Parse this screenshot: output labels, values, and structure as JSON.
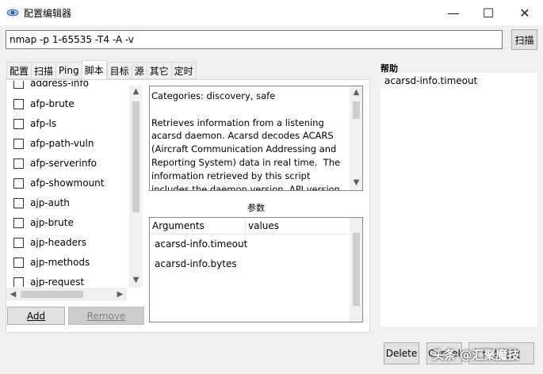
{
  "window": {
    "title": "配置编辑器",
    "controls": {
      "minimize": "—",
      "maximize": "☐",
      "close": "✕"
    }
  },
  "command": {
    "value": "nmap -p 1-65535 -T4 -A -v",
    "scan_label": "扫描"
  },
  "tabs": [
    {
      "label": "配置"
    },
    {
      "label": "扫描"
    },
    {
      "label": "Ping"
    },
    {
      "label": "脚本",
      "active": true
    },
    {
      "label": "目标"
    },
    {
      "label": "源"
    },
    {
      "label": "其它"
    },
    {
      "label": "定时"
    }
  ],
  "scripts": {
    "items": [
      "address-info",
      "afp-brute",
      "afp-ls",
      "afp-path-vuln",
      "afp-serverinfo",
      "afp-showmount",
      "ajp-auth",
      "ajp-brute",
      "ajp-headers",
      "ajp-methods",
      "ajp-request"
    ],
    "add_label": "Add",
    "remove_label": "Remove"
  },
  "description": {
    "text": "Categories: discovery, safe\n\nRetrieves information from a listening\nacarsd daemon. Acarsd decodes ACARS\n(Aircraft Communication Addressing and\nReporting System) data in real time.  The\ninformation retrieved by this script\nincludes the daemon version, API version"
  },
  "arguments": {
    "title": "参数",
    "col_arguments": "Arguments",
    "col_values": "values",
    "rows": [
      "acarsd-info.timeout",
      "acarsd-info.bytes"
    ]
  },
  "help": {
    "title": "帮助",
    "text": "acarsd-info.timeout"
  },
  "footer": {
    "delete_label": "Delete",
    "cancel_label": "Cancel",
    "save_label": "保存更改"
  },
  "watermark": "头条 @汇聚魔技",
  "colors": {
    "button_bg": "#e1e1e1",
    "panel_bg": "#ffffff",
    "window_bg": "#f0f0f0"
  }
}
